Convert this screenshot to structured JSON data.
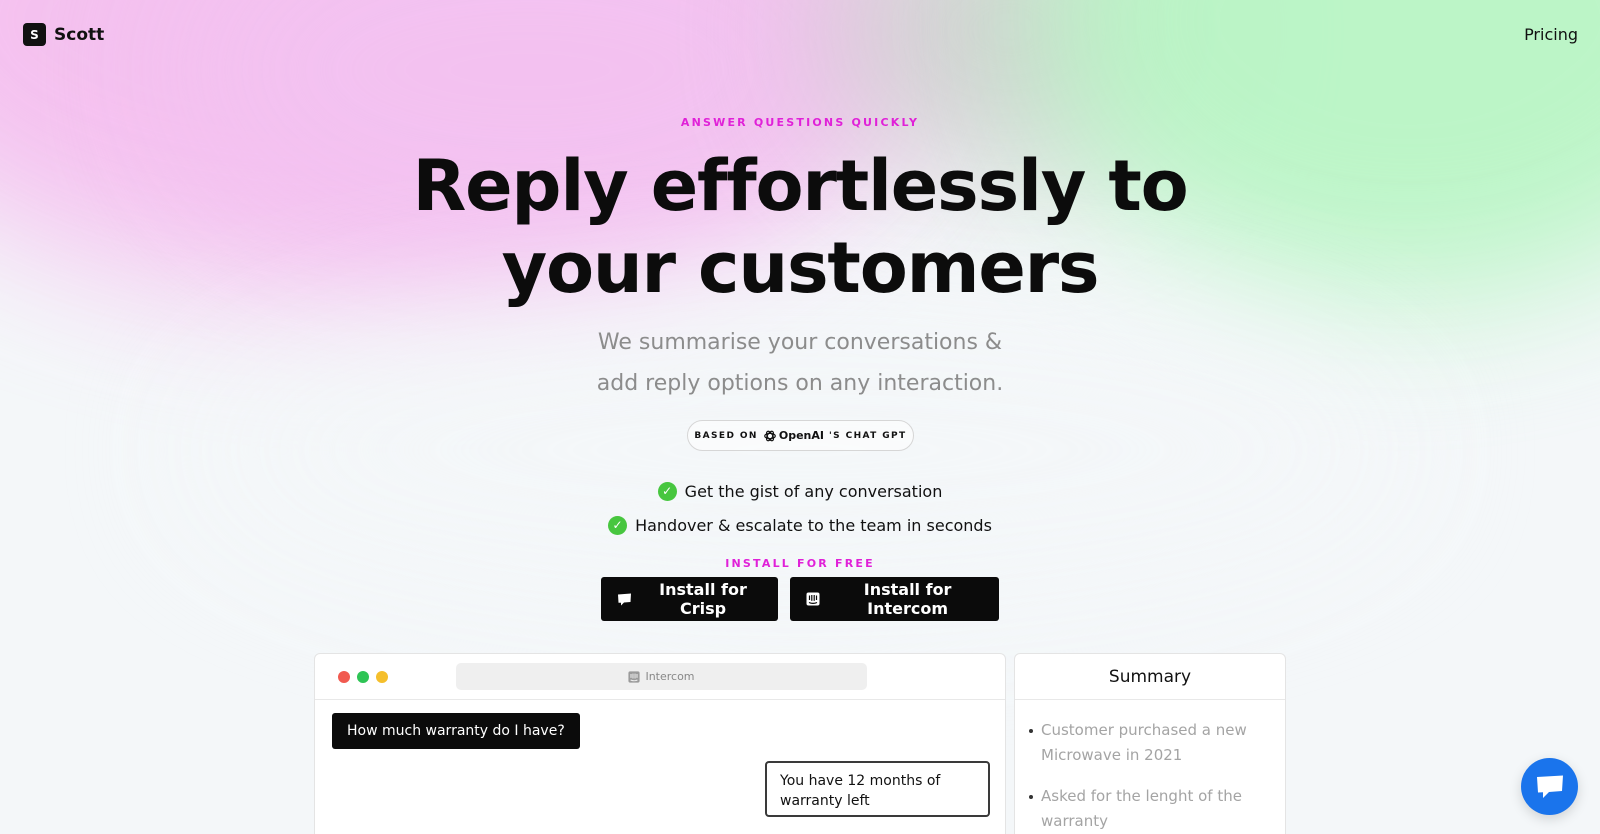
{
  "header": {
    "brand_initial": "S",
    "brand_name": "Scott",
    "nav_pricing": "Pricing"
  },
  "hero": {
    "eyebrow": "ANSWER QUESTIONS QUICKLY",
    "title_line1": "Reply effortlessly to",
    "title_line2": "your customers",
    "subtitle_line1": "We summarise your conversations &",
    "subtitle_line2": "add reply options on any interaction.",
    "badge_prefix": "BASED ON",
    "badge_brand": "OpenAI",
    "badge_suffix": "'S CHAT GPT"
  },
  "features": [
    {
      "text": "Get the gist of any conversation"
    },
    {
      "text": "Handover & escalate to the team in seconds"
    }
  ],
  "install": {
    "eyebrow": "INSTALL FOR FREE",
    "crisp_label": "Install for Crisp",
    "intercom_label": "Install for Intercom"
  },
  "chat_preview": {
    "app_name": "Intercom",
    "messages": [
      {
        "from": "customer",
        "text": "How much warranty do I have?"
      },
      {
        "from": "agent",
        "text": "You have 12 months of warranty left"
      }
    ]
  },
  "summary": {
    "title": "Summary",
    "items": [
      "Customer purchased a new Microwave in 2021",
      "Asked for the lenght of the warranty"
    ]
  },
  "icons": {
    "check": "check-circle-icon",
    "crisp": "chat-bubble-icon",
    "intercom": "intercom-icon",
    "openai": "openai-logo-icon",
    "launcher": "chat-launcher-icon"
  },
  "colors": {
    "accent_magenta": "#e021d8",
    "check_green": "#47c63f",
    "button_dark": "#0b0b0b",
    "launcher_blue": "#1a74ec"
  }
}
